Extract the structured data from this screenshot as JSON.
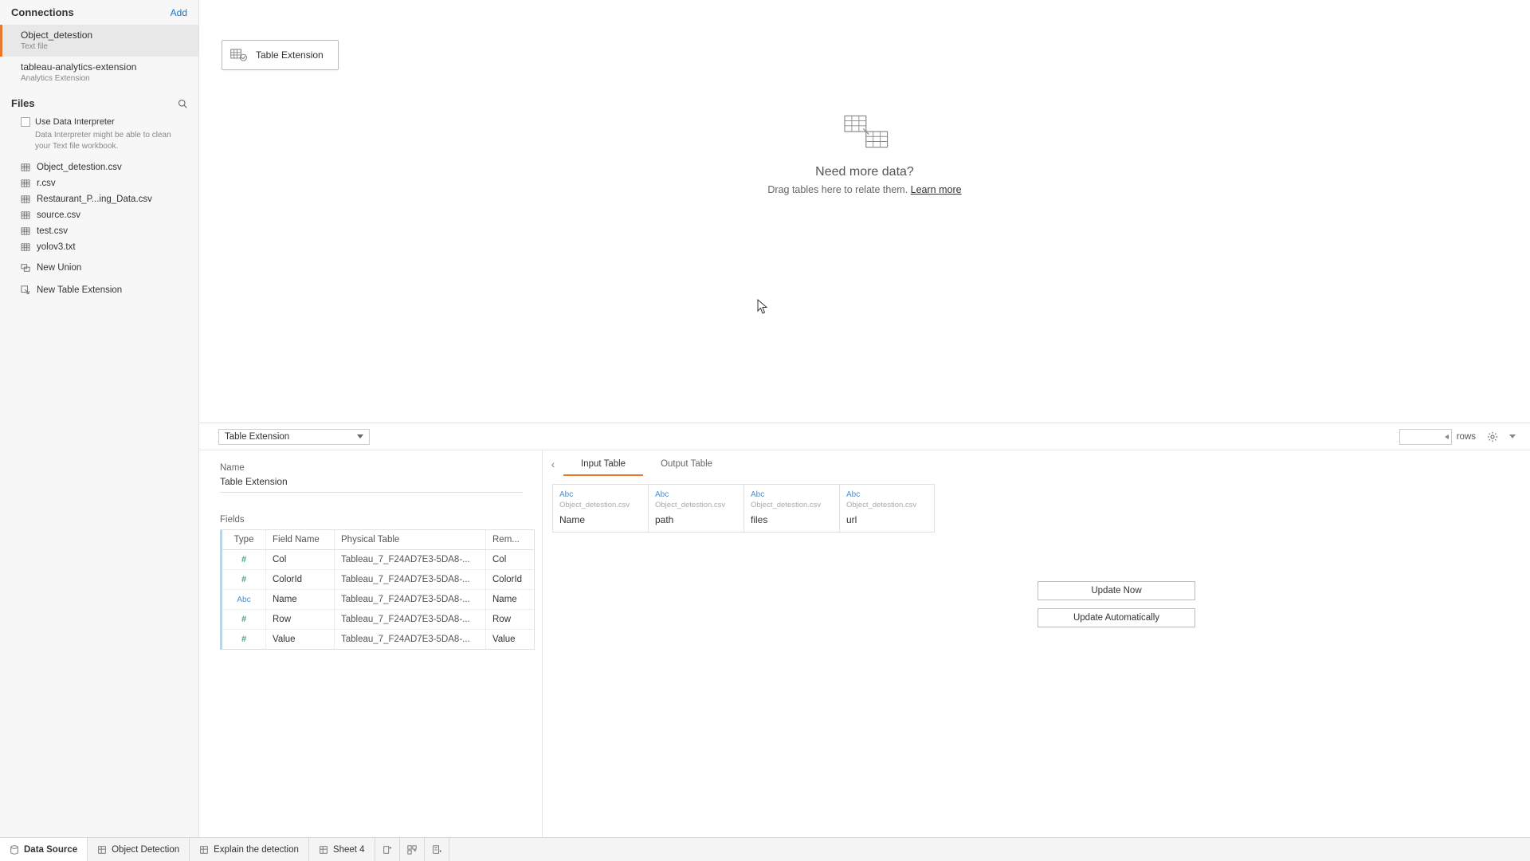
{
  "sidebar": {
    "connections_title": "Connections",
    "add_label": "Add",
    "connections": [
      {
        "name": "Object_detestion",
        "sub": "Text file",
        "active": true
      },
      {
        "name": "tableau-analytics-extension",
        "sub": "Analytics Extension",
        "active": false
      }
    ],
    "files_title": "Files",
    "interpreter_label": "Use Data Interpreter",
    "interpreter_help": "Data Interpreter might be able to clean your Text file workbook.",
    "files": [
      "Object_detestion.csv",
      "r.csv",
      "Restaurant_P...ing_Data.csv",
      "source.csv",
      "test.csv",
      "yolov3.txt"
    ],
    "new_union": "New Union",
    "new_table_ext": "New Table Extension"
  },
  "canvas": {
    "pill_label": "Table Extension",
    "need_more_title": "Need more data?",
    "need_more_sub": "Drag tables here to relate them. ",
    "learn_more": "Learn more"
  },
  "lower": {
    "selector": "Table Extension",
    "rows_label": "rows",
    "details_name_label": "Name",
    "details_name_value": "Table Extension",
    "fields_label": "Fields",
    "fields_headers": {
      "type": "Type",
      "fname": "Field Name",
      "ptab": "Physical Table",
      "rem": "Rem..."
    },
    "fields": [
      {
        "t": "#",
        "name": "Col",
        "pt": "Tableau_7_F24AD7E3-5DA8-...",
        "rem": "Col"
      },
      {
        "t": "#",
        "name": "ColorId",
        "pt": "Tableau_7_F24AD7E3-5DA8-...",
        "rem": "ColorId"
      },
      {
        "t": "Abc",
        "name": "Name",
        "pt": "Tableau_7_F24AD7E3-5DA8-...",
        "rem": "Name"
      },
      {
        "t": "#",
        "name": "Row",
        "pt": "Tableau_7_F24AD7E3-5DA8-...",
        "rem": "Row"
      },
      {
        "t": "#",
        "name": "Value",
        "pt": "Tableau_7_F24AD7E3-5DA8-...",
        "rem": "Value"
      }
    ],
    "tab_input": "Input Table",
    "tab_output": "Output Table",
    "io_cols": [
      {
        "type": "Abc",
        "src": "Object_detestion.csv",
        "name": "Name"
      },
      {
        "type": "Abc",
        "src": "Object_detestion.csv",
        "name": "path"
      },
      {
        "type": "Abc",
        "src": "Object_detestion.csv",
        "name": "files"
      },
      {
        "type": "Abc",
        "src": "Object_detestion.csv",
        "name": "url"
      }
    ],
    "update_now": "Update Now",
    "update_auto": "Update Automatically"
  },
  "bottom": {
    "data_source": "Data Source",
    "tabs": [
      "Object Detection",
      "Explain the detection",
      "Sheet 4"
    ]
  }
}
